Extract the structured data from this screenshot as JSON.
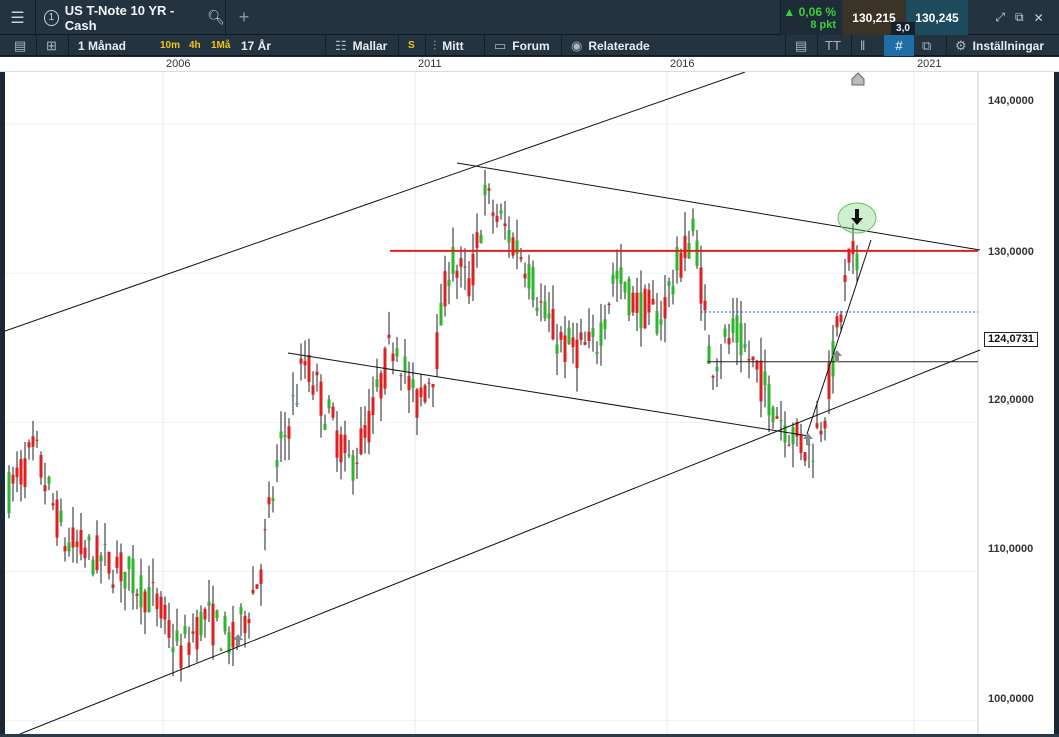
{
  "topbar": {
    "menu_icon": "hamburger-icon",
    "instrument_number": "1",
    "instrument_name": "US T-Note 10 YR - Cash",
    "add_icon": "plus-icon",
    "change_pct": "▲ 0,06 %",
    "change_pts": "8 pkt",
    "bid": "130,215",
    "ask": "130,245",
    "spread": "3,0",
    "up_color": "#3bcf3b"
  },
  "toolbar": {
    "timeframe": "1 Månad",
    "tf_10m": "10m",
    "tf_4h": "4h",
    "tf_1ma": "1Må",
    "period": "17 År",
    "templates": "Mallar",
    "s_label": "S",
    "mine": "Mitt",
    "forum": "Forum",
    "related": "Relaterade",
    "text_tool": "TT",
    "settings": "Inställningar",
    "accent_color": "#f0c419"
  },
  "date_axis": [
    "2006",
    "2011",
    "2016",
    "2021"
  ],
  "chart_data": {
    "type": "candlestick",
    "instrument": "US T-Note 10 YR - Cash",
    "x_ticks": [
      "2006",
      "2011",
      "2016",
      "2021"
    ],
    "y_ticks": [
      "140,0000",
      "130,0000",
      "120,0000",
      "110,0000",
      "100,0000"
    ],
    "ylim": [
      99.1,
      143.5
    ],
    "price_label": "124,0731",
    "horizontal_lines": [
      {
        "price": 131.5,
        "style": "solid",
        "color": "#e02020"
      },
      {
        "price": 127.4,
        "style": "dotted",
        "color": "#1f5fd0"
      },
      {
        "price": 124.07,
        "style": "solid",
        "color": "#222222"
      }
    ],
    "up_color": "#2db52d",
    "down_color": "#e02020",
    "grid": true
  }
}
